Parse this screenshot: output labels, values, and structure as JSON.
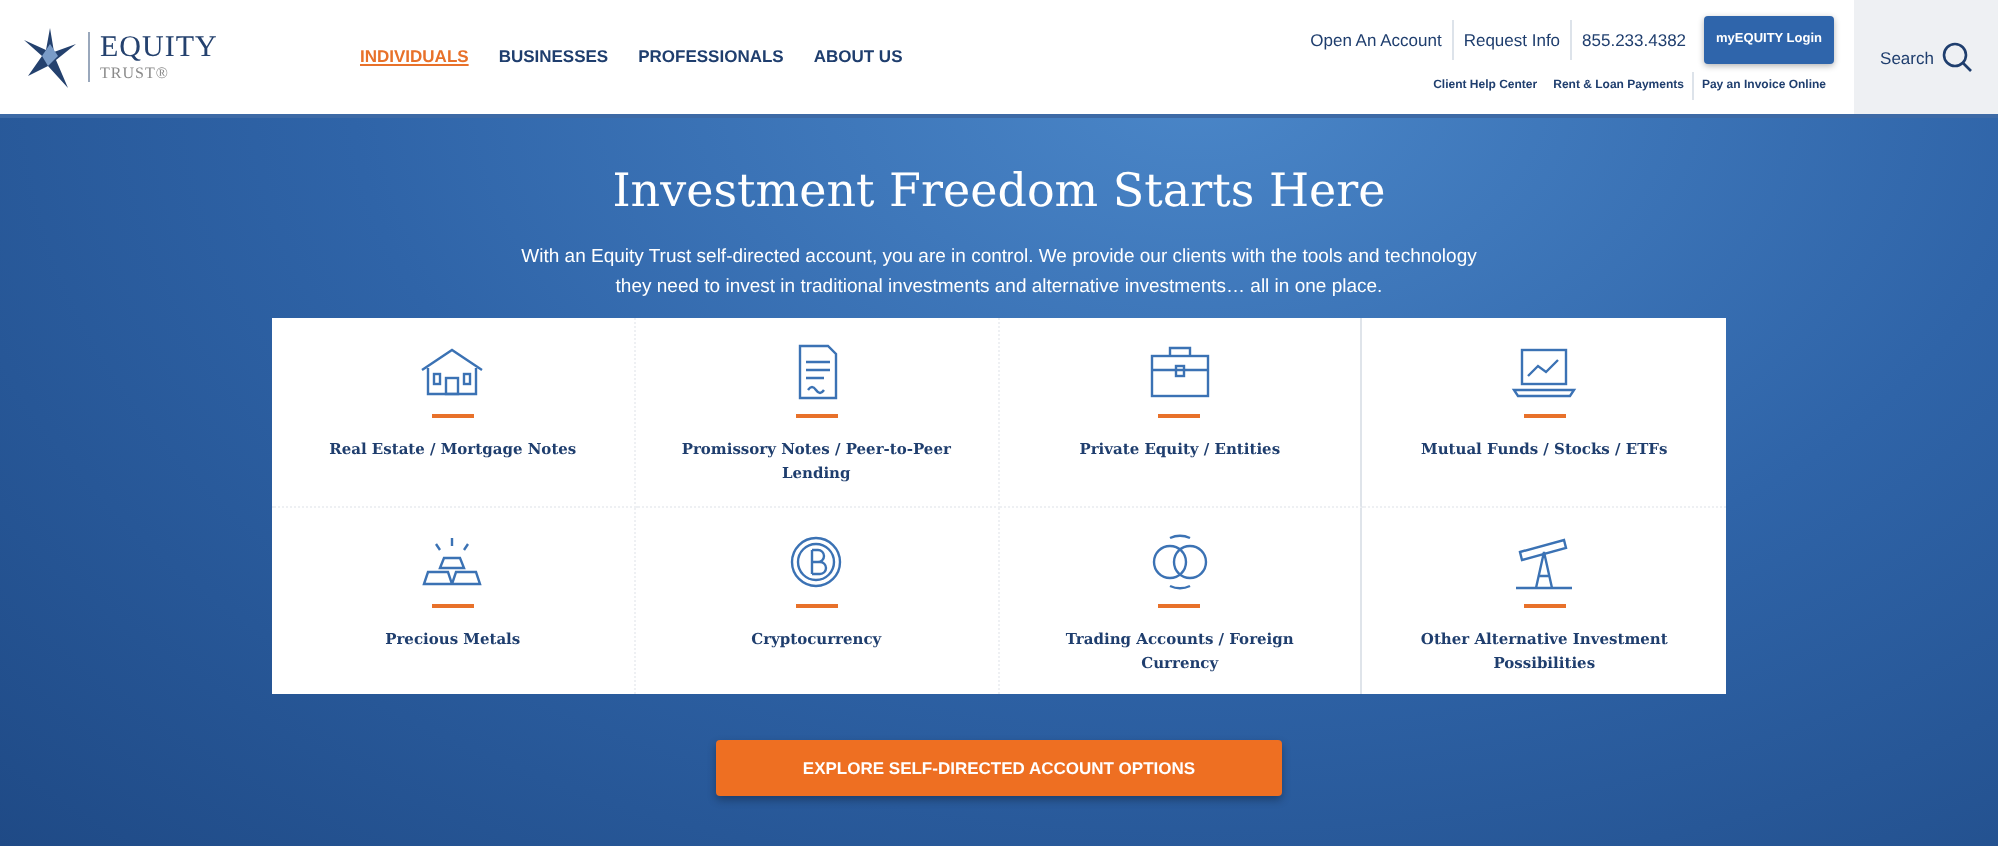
{
  "logo": {
    "name": "EQUITY",
    "sub": "TRUST®"
  },
  "nav": [
    {
      "label": "INDIVIDUALS",
      "selected": true
    },
    {
      "label": "BUSINESSES",
      "selected": false
    },
    {
      "label": "PROFESSIONALS",
      "selected": false
    },
    {
      "label": "ABOUT US",
      "selected": false
    }
  ],
  "top_links": [
    "Open An Account",
    "Request Info",
    "855.233.4382"
  ],
  "login_button": "myEQUITY Login",
  "sub_links": [
    "Client Help Center",
    "Rent & Loan Payments",
    "Pay an Invoice Online"
  ],
  "search": "Search",
  "hero": {
    "title": "Investment Freedom Starts Here",
    "text": "With an Equity Trust self-directed account, you are in control. We provide our clients with the tools and technology they need to invest in traditional investments and alternative investments… all in one place."
  },
  "categories": [
    {
      "label": "Real Estate / Mortgage Notes"
    },
    {
      "label": "Promissory Notes / Peer-to-Peer Lending"
    },
    {
      "label": "Private Equity / Entities"
    },
    {
      "label": "Mutual Funds / Stocks / ETFs"
    },
    {
      "label": "Precious Metals"
    },
    {
      "label": "Cryptocurrency"
    },
    {
      "label": "Trading Accounts / Foreign Currency"
    },
    {
      "label": "Other Alternative Investment Possibilities"
    }
  ],
  "cta": "EXPLORE SELF-DIRECTED ACCOUNT OPTIONS"
}
